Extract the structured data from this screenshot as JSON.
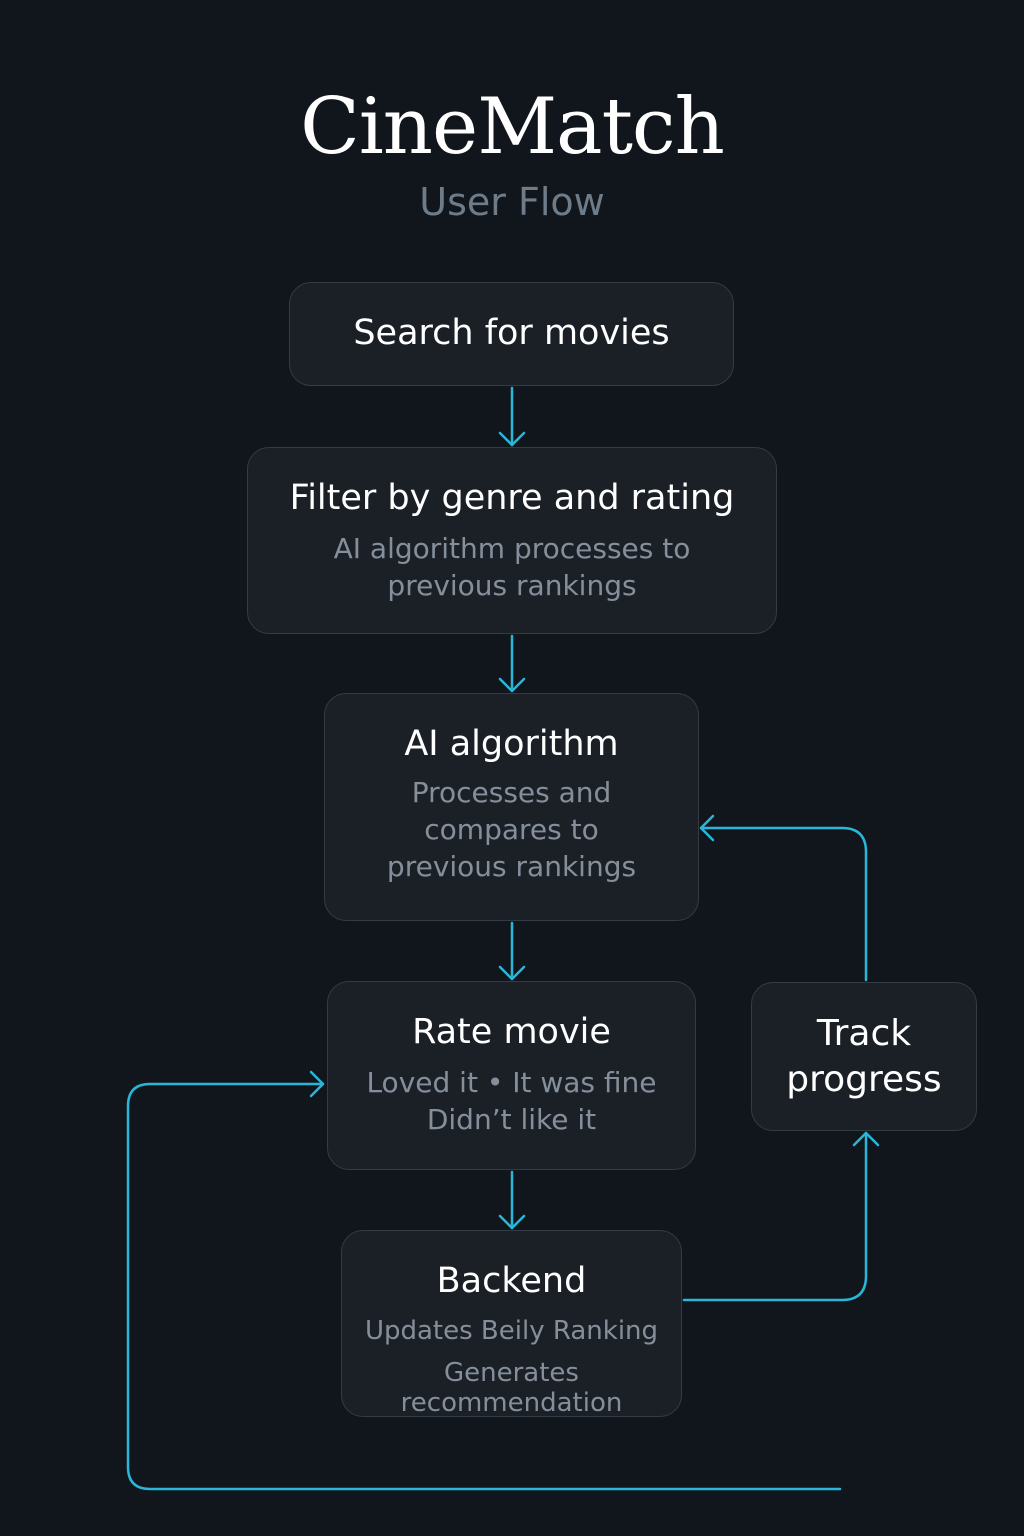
{
  "header": {
    "title": "CineMatch",
    "subtitle": "User Flow"
  },
  "nodes": {
    "search": {
      "title": "Search for movies"
    },
    "filter": {
      "title": "Filter by genre and rating",
      "description": "AI algorithm processes to previous rankings"
    },
    "ai": {
      "title": "AI algorithm",
      "description": "Processes and compares to previous rankings"
    },
    "rate": {
      "title": "Rate movie",
      "line1": "Loved it • It was fine",
      "line2": "Didn’t like it"
    },
    "backend": {
      "title": "Backend",
      "line1": "Updates Beily Ranking",
      "line2": "Generates recommendation"
    },
    "track": {
      "title": "Track progress"
    }
  },
  "colors": {
    "background": "#11161c",
    "node_fill": "#1b2027",
    "node_border": "#333b45",
    "connector": "#29b6d8",
    "title": "#ffffff",
    "muted_text": "#858f9b"
  }
}
